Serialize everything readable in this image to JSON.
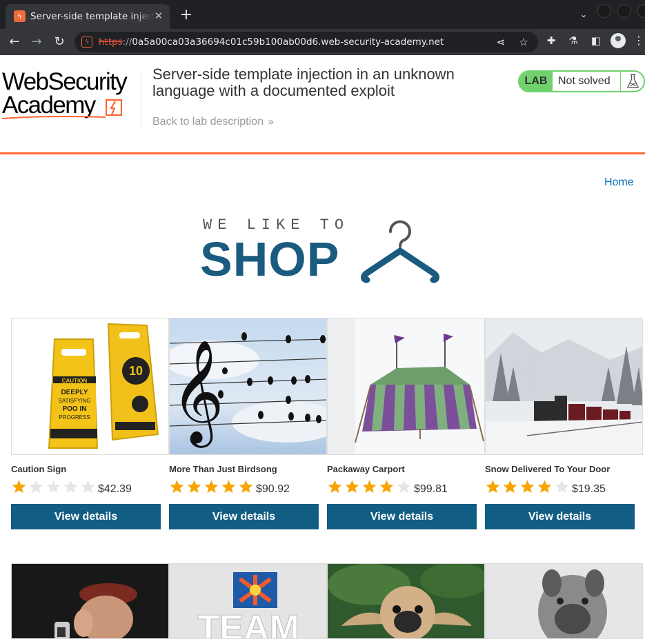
{
  "browser": {
    "tab_title": "Server-side template injection in an unknown language with a documented exploit",
    "tab_close": "✕",
    "new_tab": "+",
    "url_scheme": "https",
    "url_sep": "://",
    "url_host": "0a5a00ca03a36694c01c59b100ab00d6.web-security-academy.net"
  },
  "header": {
    "logo_line1": "WebSecurity",
    "logo_line2": "Academy",
    "lab_title": "Server-side template injection in an unknown language with a documented exploit",
    "back_link": "Back to lab description",
    "back_chevron": "»",
    "lab_badge": "LAB",
    "lab_status": "Not solved",
    "colors": {
      "accent": "#ff6633",
      "lab_green": "#70d16d"
    }
  },
  "nav": {
    "home": "Home"
  },
  "banner": {
    "top": "WE LIKE TO",
    "shop": "SHOP",
    "color": "#1a5b7f"
  },
  "products": [
    {
      "name": "Caution Sign",
      "rating": 1,
      "price": "$42.39",
      "button": "View details"
    },
    {
      "name": "More Than Just Birdsong",
      "rating": 5,
      "price": "$90.92",
      "button": "View details"
    },
    {
      "name": "Packaway Carport",
      "rating": 4,
      "price": "$99.81",
      "button": "View details"
    },
    {
      "name": "Snow Delivered To Your Door",
      "rating": 4,
      "price": "$19.35",
      "button": "View details"
    }
  ],
  "second_row_thumb_text": "TEAM",
  "colors": {
    "button": "#115d84",
    "star_on": "#f7a400",
    "star_off": "#e4e6ea",
    "link": "#0071bc"
  }
}
